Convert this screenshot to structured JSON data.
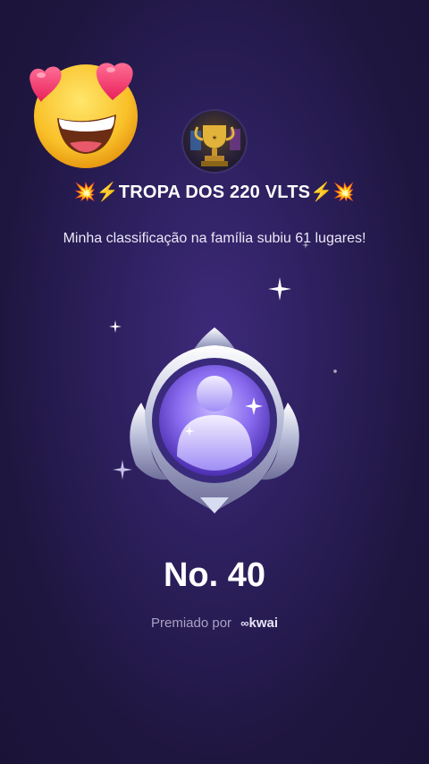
{
  "header": {
    "group_name": "💥⚡TROPA DOS 220 VLTS⚡💥",
    "message": "Minha classificação na família subiu 61 lugares!"
  },
  "rank": {
    "label": "No. 40"
  },
  "footer": {
    "awarded_by_label": "Premiado por",
    "brand": "kwai"
  },
  "colors": {
    "background": "#2c1f5c",
    "badge_purple": "#8a6df0",
    "text_muted": "#a9a2c4"
  },
  "icons": [
    "heart-eyes-emoji-icon",
    "trophy-avatar-icon",
    "family-rank-badge-icon",
    "sparkle-icon",
    "kwai-logo-icon"
  ]
}
